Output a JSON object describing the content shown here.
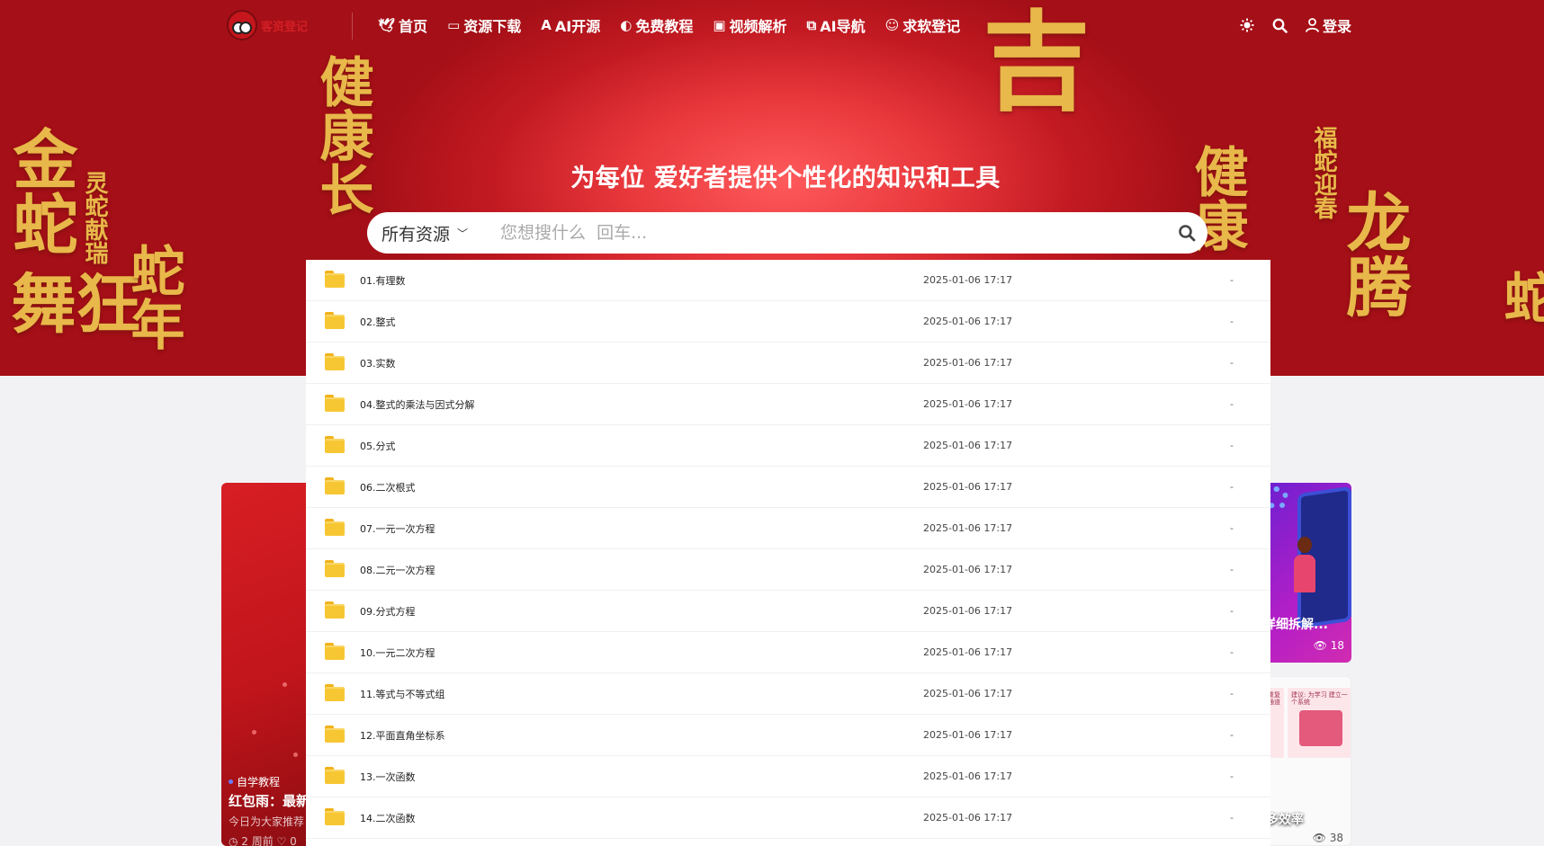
{
  "nav": {
    "logo_text": "客资登记",
    "menu": [
      {
        "icon": "bird-icon",
        "glyph": "🕊",
        "label": "首页"
      },
      {
        "icon": "laptop-icon",
        "glyph": "▭",
        "label": "资源下载"
      },
      {
        "icon": "letter-a-icon",
        "glyph": "A",
        "label": "AI开源"
      },
      {
        "icon": "edge-browser-icon",
        "glyph": "◐",
        "label": "免费教程"
      },
      {
        "icon": "video-play-icon",
        "glyph": "▣",
        "label": "视频解析"
      },
      {
        "icon": "chat-bubbles-icon",
        "glyph": "⧉",
        "label": "AI导航"
      },
      {
        "icon": "smiley-icon",
        "glyph": "☺",
        "label": "求软登记"
      }
    ],
    "login_label": "登录"
  },
  "hero": {
    "slogan": "为每位 爱好者提供个性化的知识和工具",
    "decorations": [
      "金蛇狂舞",
      "灵蛇献瑞",
      "蛇年大吉",
      "健康长寿",
      "吉",
      "健康",
      "福蛇迎春",
      "龙腾",
      "灵蛇"
    ]
  },
  "search": {
    "category": "所有资源",
    "placeholder": "您想搜什么  回车..."
  },
  "files": [
    {
      "name": "01.有理数",
      "date": "2025-01-06 17:17",
      "size": "-"
    },
    {
      "name": "02.整式",
      "date": "2025-01-06 17:17",
      "size": "-"
    },
    {
      "name": "03.实数",
      "date": "2025-01-06 17:17",
      "size": "-"
    },
    {
      "name": "04.整式的乘法与因式分解",
      "date": "2025-01-06 17:17",
      "size": "-"
    },
    {
      "name": "05.分式",
      "date": "2025-01-06 17:17",
      "size": "-"
    },
    {
      "name": "06.二次根式",
      "date": "2025-01-06 17:17",
      "size": "-"
    },
    {
      "name": "07.一元一次方程",
      "date": "2025-01-06 17:17",
      "size": "-"
    },
    {
      "name": "08.二元一次方程",
      "date": "2025-01-06 17:17",
      "size": "-"
    },
    {
      "name": "09.分式方程",
      "date": "2025-01-06 17:17",
      "size": "-"
    },
    {
      "name": "10.一元二次方程",
      "date": "2025-01-06 17:17",
      "size": "-"
    },
    {
      "name": "11.等式与不等式组",
      "date": "2025-01-06 17:17",
      "size": "-"
    },
    {
      "name": "12.平面直角坐标系",
      "date": "2025-01-06 17:17",
      "size": "-"
    },
    {
      "name": "13.一次函数",
      "date": "2025-01-06 17:17",
      "size": "-"
    },
    {
      "name": "14.二次函数",
      "date": "2025-01-06 17:17",
      "size": "-"
    }
  ],
  "cards": {
    "left": {
      "tag": "自学教程",
      "title": "红包雨：最新",
      "desc": "今日为大家推荐",
      "meta": "◷ 2 周前  ♡ 0"
    },
    "right_top": {
      "title": "详细拆解...",
      "views": "18"
    },
    "right_bottom": {
      "box1_text": "重复 通道",
      "box2_text": "建议: 为学习 建立一个系统",
      "title": "多效率",
      "views": "38"
    }
  },
  "colors": {
    "hero_red": "#c31a22",
    "gold": "#e8b84a",
    "folder": "#f7c733"
  }
}
